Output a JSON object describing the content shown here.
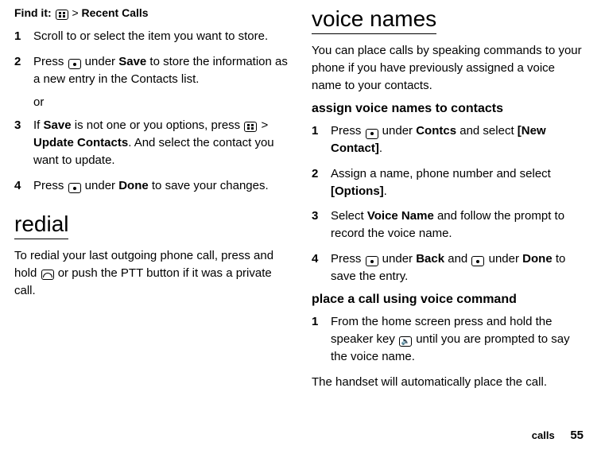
{
  "left": {
    "find_it_label": "Find it:",
    "find_it_sep": " > ",
    "find_it_target": "Recent Calls",
    "steps": {
      "s1": {
        "n": "1",
        "t": "Scroll to or select the item you want to store."
      },
      "s2": {
        "n": "2",
        "pre": "Press ",
        "mid": " under ",
        "save": "Save",
        "post": " to store the information as a new entry in the Contacts list."
      },
      "or": "or",
      "s3": {
        "n": "3",
        "pre": "If ",
        "save": "Save",
        "mid": " is not one or you options, press ",
        "sep": " > ",
        "update": "Update Contacts",
        "post": ". And select the contact you want to update."
      },
      "s4": {
        "n": "4",
        "pre": "Press ",
        "mid": " under ",
        "done": "Done",
        "post": " to save your changes."
      }
    },
    "redial_h": "redial",
    "redial_p_pre": "To redial your last outgoing phone call, press and hold ",
    "redial_p_post": " or push the PTT button if it was a private call."
  },
  "right": {
    "voice_h": "voice names",
    "voice_p": "You can place calls by speaking commands to your phone if you have previously assigned a voice name to your contacts.",
    "assign_h": "assign voice names to contacts",
    "steps": {
      "a1": {
        "n": "1",
        "pre": "Press ",
        "mid": " under ",
        "contcs": "Contcs",
        "sel": " and select ",
        "new": "[New Contact]",
        "end": "."
      },
      "a2": {
        "n": "2",
        "pre": "Assign a name, phone number and select ",
        "opt": "[Options]",
        "end": "."
      },
      "a3": {
        "n": "3",
        "pre": "Select ",
        "vn": "Voice Name",
        "post": " and follow the prompt to record the voice name."
      },
      "a4": {
        "n": "4",
        "pre": "Press ",
        "mid1": " under ",
        "back": "Back",
        "and": " and ",
        "mid2": " under ",
        "done": "Done",
        "post": " to save the entry."
      }
    },
    "place_h": "place a call using voice command",
    "p1": {
      "n": "1",
      "pre": "From the home screen press and hold the speaker key ",
      "post": " until you are prompted to say the voice name."
    },
    "p_end": "The handset will automatically place the call."
  },
  "footer": {
    "section": "calls",
    "page": "55"
  }
}
